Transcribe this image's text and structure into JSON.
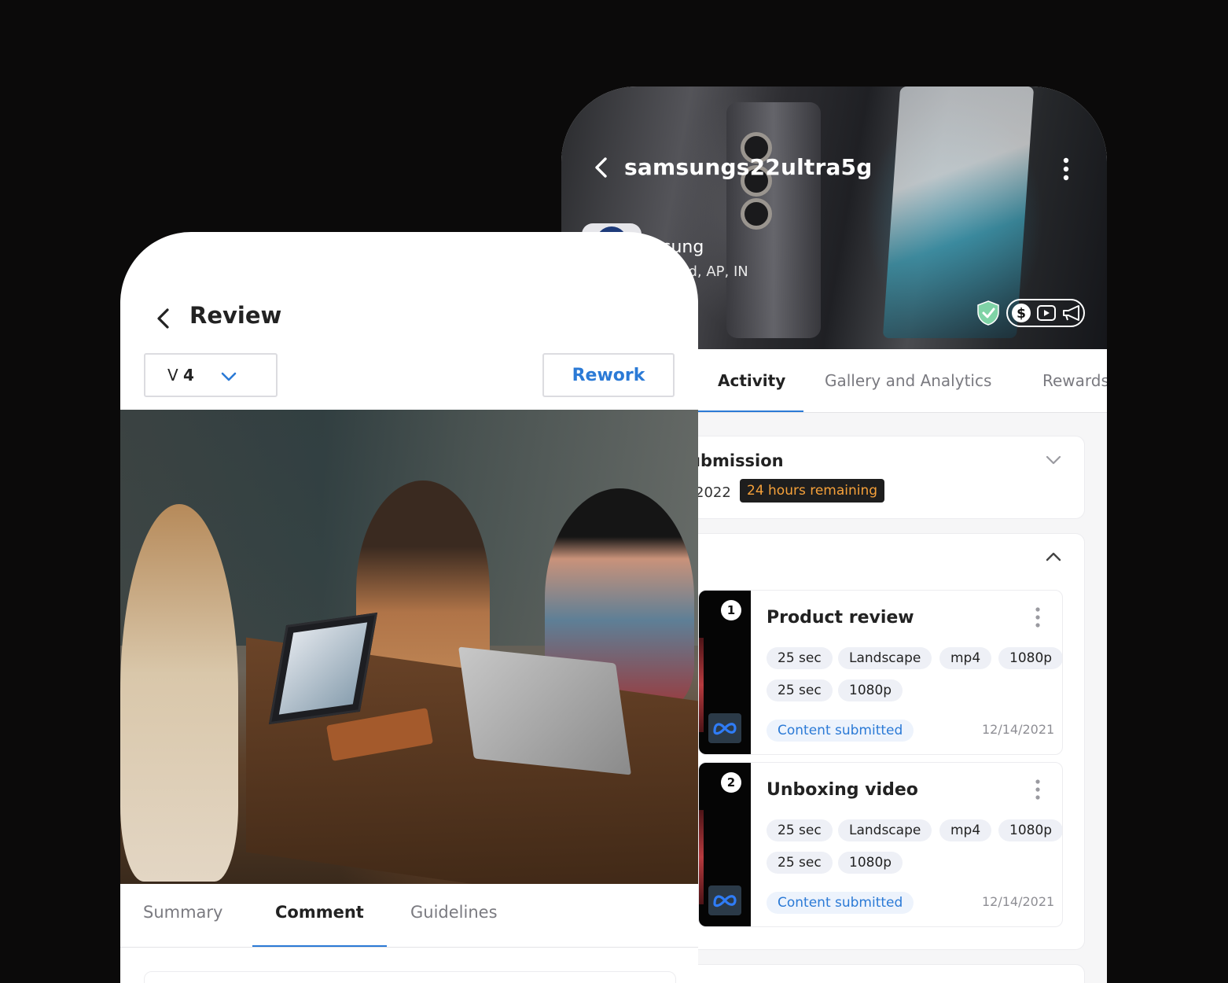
{
  "back_screen": {
    "campaign_title": "samsungs22ultra5g",
    "brand_name_partial": "sung",
    "location_partial": "abad, AP, IN",
    "icons": [
      "back-arrow-icon",
      "more-vertical-icon",
      "shield-check-icon",
      "dollar-icon",
      "video-icon",
      "megaphone-icon"
    ],
    "tabs": [
      {
        "label": "Activity",
        "active": true
      },
      {
        "label": "Gallery and Analytics",
        "active": false
      },
      {
        "label": "Rewards",
        "active": false
      }
    ],
    "submission": {
      "title_partial": "ubmission",
      "date_partial": "2022",
      "badge": "24 hours remaining"
    },
    "deliverables": [
      {
        "index": "1",
        "title": "Product review",
        "chips": [
          "25 sec",
          "Landscape",
          "mp4",
          "1080p",
          "25 sec",
          "1080p"
        ],
        "status": "Content submitted",
        "date": "12/14/2021"
      },
      {
        "index": "2",
        "title": "Unboxing video",
        "chips": [
          "25 sec",
          "Landscape",
          "mp4",
          "1080p",
          "25 sec",
          "1080p"
        ],
        "status": "Content submitted",
        "date": "12/14/2021"
      }
    ]
  },
  "front_screen": {
    "title": "Review",
    "version": {
      "prefix": "V",
      "number": "4"
    },
    "rework_label": "Rework",
    "tabs": [
      {
        "label": "Summary",
        "active": false
      },
      {
        "label": "Comment",
        "active": true
      },
      {
        "label": "Guidelines",
        "active": false
      }
    ]
  },
  "colors": {
    "accent": "#2b7ad6",
    "badge_text": "#f6a13a",
    "badge_bg": "#1e1e1e",
    "background": "#0b0a0a",
    "chip_bg": "#eef0f6"
  }
}
